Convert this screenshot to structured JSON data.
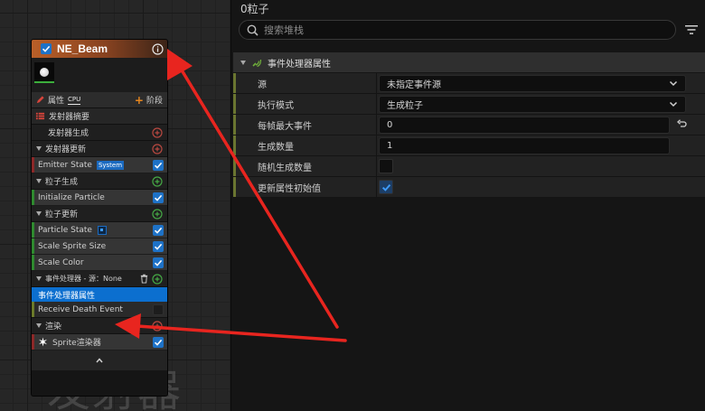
{
  "node": {
    "title": "NE_Beam",
    "properties_label": "属性",
    "cpu_label": "CPU",
    "stage_label": "阶段",
    "summary_label": "发射器摘要",
    "emitter_spawn_label": "发射器生成",
    "emitter_update_label": "发射器更新",
    "emitter_state_label": "Emitter State",
    "system_badge": "System",
    "particle_spawn_label": "粒子生成",
    "initialize_particle_label": "Initialize Particle",
    "particle_update_label": "粒子更新",
    "particle_state_label": "Particle State",
    "scale_sprite_size_label": "Scale Sprite Size",
    "scale_color_label": "Scale Color",
    "event_handler_label": "事件处理器 - 源：None",
    "event_handler_props_label": "事件处理器属性",
    "receive_death_event_label": "Receive Death Event",
    "render_label": "渲染",
    "sprite_renderer_label": "Sprite渲染器",
    "header_color": "#b95f28"
  },
  "watermark": "发射器",
  "panel": {
    "title": "0粒子",
    "search_placeholder": "搜索堆栈",
    "section_title": "事件处理器属性",
    "rows": [
      {
        "label": "源",
        "value": "未指定事件源"
      },
      {
        "label": "执行模式",
        "value": "生成粒子"
      },
      {
        "label": "每帧最大事件",
        "value": "0"
      },
      {
        "label": "生成数量",
        "value": "1"
      },
      {
        "label": "随机生成数量",
        "checked": false
      },
      {
        "label": "更新属性初始值",
        "checked": true
      }
    ]
  },
  "colors": {
    "accent_blue": "#0c6fcf",
    "arrow_red": "#e8251f",
    "stage_orange": "#e8871e"
  },
  "icons": [
    "info-icon",
    "search-icon",
    "filter-icon",
    "chevron-down-icon",
    "reset-arrow-icon",
    "plus-circle-icon",
    "trash-icon",
    "pencil-icon",
    "list-icon",
    "sprite-icon",
    "chevron-up-icon",
    "module-icon"
  ]
}
